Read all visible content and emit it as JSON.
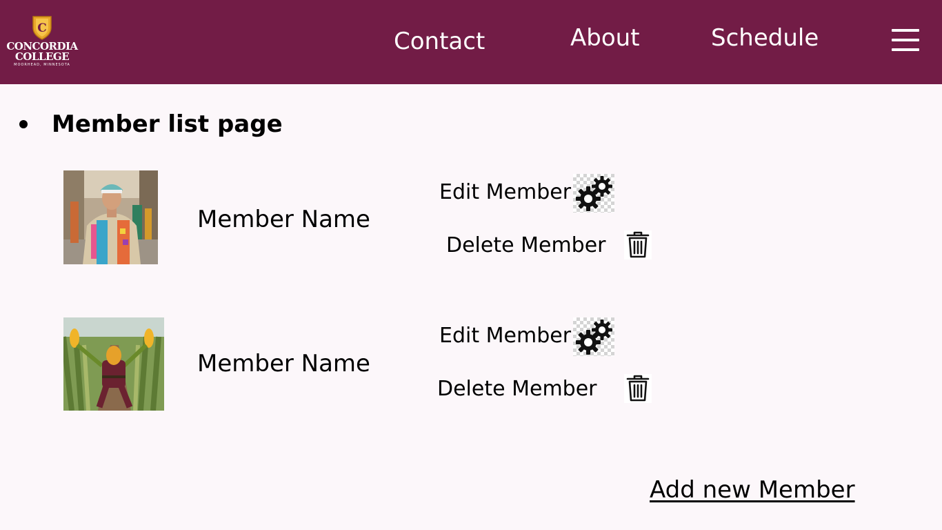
{
  "header": {
    "logo": {
      "line1": "CONCORDIA",
      "line2": "COLLEGE",
      "location": "MOORHEAD, MINNESOTA",
      "shield_letter": "C"
    },
    "nav": {
      "contact": "Contact",
      "about": "About",
      "schedule": "Schedule",
      "menu_icon": "hamburger-icon"
    },
    "colors": {
      "brand": "#721c46",
      "gold": "#e8a72a"
    }
  },
  "main": {
    "heading": "Member list page",
    "members": [
      {
        "name": "Member Name",
        "photo": "person in colorful patchwork outfit on city street",
        "edit_label": "Edit Member",
        "delete_label": "Delete Member"
      },
      {
        "name": "Member Name",
        "photo": "corn mascot in cornfield",
        "edit_label": "Edit Member",
        "delete_label": "Delete Member"
      }
    ],
    "add_label": "Add new Member",
    "icons": {
      "edit": "gears-icon",
      "delete": "trash-icon"
    }
  }
}
